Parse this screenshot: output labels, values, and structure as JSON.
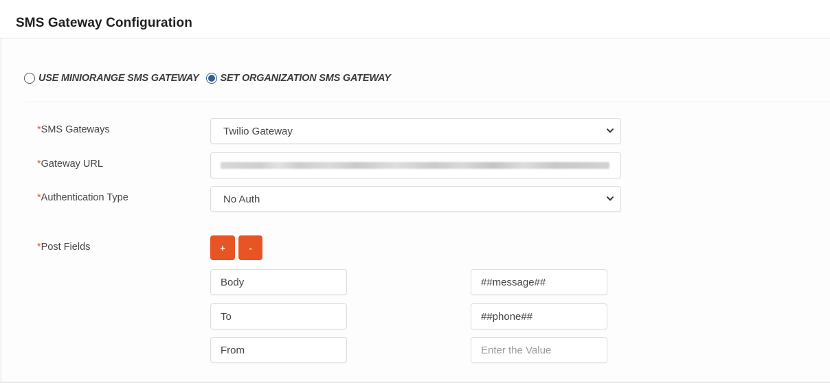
{
  "header": {
    "title": "SMS Gateway Configuration"
  },
  "gateway_mode": {
    "options": [
      {
        "label": "USE MINIORANGE SMS GATEWAY",
        "selected": false
      },
      {
        "label": "SET ORGANIZATION SMS GATEWAY",
        "selected": true
      }
    ]
  },
  "form": {
    "required_marker": "*",
    "sms_gateways": {
      "label": "SMS Gateways",
      "value": "Twilio Gateway"
    },
    "gateway_url": {
      "label": "Gateway URL",
      "value": "[blurred]"
    },
    "auth_type": {
      "label": "Authentication Type",
      "value": "No Auth"
    },
    "post_fields": {
      "label": "Post Fields",
      "add_label": "+",
      "remove_label": "-",
      "rows": [
        {
          "key": "Body",
          "value": "##message##",
          "value_placeholder": "Enter the Value"
        },
        {
          "key": "To",
          "value": "##phone##",
          "value_placeholder": "Enter the Value"
        },
        {
          "key": "From",
          "value": "",
          "value_placeholder": "Enter the Value"
        }
      ]
    }
  },
  "colors": {
    "accent": "#e95424",
    "radio_selected": "#2e5f93",
    "required": "#e0593a"
  }
}
